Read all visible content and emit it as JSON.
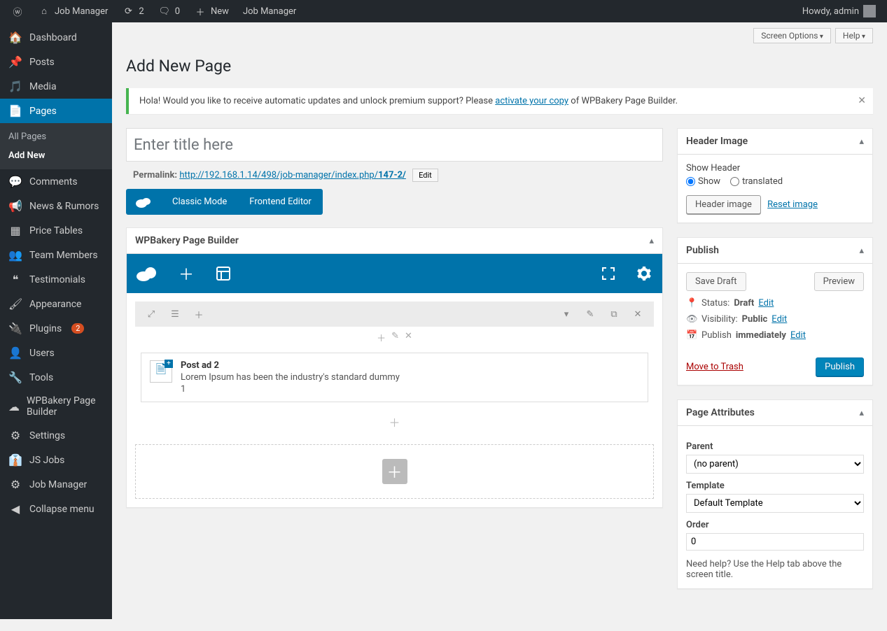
{
  "adminbar": {
    "site": "Job Manager",
    "updates": "2",
    "comments": "0",
    "new": "New",
    "extra": "Job Manager",
    "greeting": "Howdy, admin"
  },
  "sidebar": {
    "items": [
      {
        "icon": "dashboard",
        "label": "Dashboard"
      },
      {
        "icon": "pin",
        "label": "Posts"
      },
      {
        "icon": "media",
        "label": "Media"
      },
      {
        "icon": "page",
        "label": "Pages",
        "active": true
      },
      {
        "icon": "comment",
        "label": "Comments"
      },
      {
        "icon": "megaphone",
        "label": "News & Rumors"
      },
      {
        "icon": "table",
        "label": "Price Tables"
      },
      {
        "icon": "team",
        "label": "Team Members"
      },
      {
        "icon": "quote",
        "label": "Testimonials"
      },
      {
        "icon": "brush",
        "label": "Appearance"
      },
      {
        "icon": "plug",
        "label": "Plugins",
        "badge": "2"
      },
      {
        "icon": "user",
        "label": "Users"
      },
      {
        "icon": "wrench",
        "label": "Tools"
      },
      {
        "icon": "cloud",
        "label": "WPBakery Page Builder"
      },
      {
        "icon": "settings",
        "label": "Settings"
      },
      {
        "icon": "tie",
        "label": "JS Jobs"
      },
      {
        "icon": "gear",
        "label": "Job Manager"
      },
      {
        "icon": "collapse",
        "label": "Collapse menu"
      }
    ],
    "submenu": [
      {
        "label": "All Pages"
      },
      {
        "label": "Add New",
        "current": true
      }
    ]
  },
  "top_right": {
    "screen_options": "Screen Options",
    "help": "Help"
  },
  "page_title": "Add New Page",
  "notice": {
    "pre": "Hola! Would you like to receive automatic updates and unlock premium support? Please ",
    "link": "activate your copy",
    "post": " of WPBakery Page Builder."
  },
  "editor": {
    "title_placeholder": "Enter title here",
    "permalink_label": "Permalink:",
    "permalink_base": "http://192.168.1.14/498/job-manager/index.php/",
    "permalink_slug": "147-2/",
    "edit": "Edit",
    "classic_mode": "Classic Mode",
    "frontend_editor": "Frontend Editor"
  },
  "vc": {
    "panel_title": "WPBakery Page Builder",
    "element": {
      "title": "Post ad 2",
      "desc": "Lorem Ipsum has been the industry's standard dummy",
      "extra": "1"
    }
  },
  "header_box": {
    "title": "Header Image",
    "show_header": "Show Header",
    "opt_show": "Show",
    "opt_translated": "translated",
    "btn": "Header image",
    "reset": "Reset image"
  },
  "publish": {
    "title": "Publish",
    "save_draft": "Save Draft",
    "preview": "Preview",
    "status_label": "Status:",
    "status_val": "Draft",
    "visibility_label": "Visibility:",
    "visibility_val": "Public",
    "publish_label": "Publish",
    "publish_val": "immediately",
    "edit": "Edit",
    "trash": "Move to Trash",
    "publish_btn": "Publish"
  },
  "attrs": {
    "title": "Page Attributes",
    "parent": "Parent",
    "parent_val": "(no parent)",
    "template": "Template",
    "template_val": "Default Template",
    "order": "Order",
    "order_val": "0",
    "help": "Need help? Use the Help tab above the screen title."
  }
}
